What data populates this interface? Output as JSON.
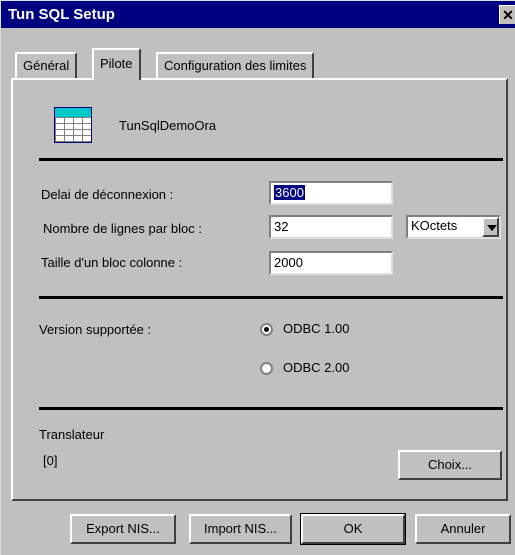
{
  "window": {
    "title": "Tun SQL Setup",
    "close_glyph": "✕"
  },
  "tabs": [
    {
      "label": "Général",
      "active": false
    },
    {
      "label": "Pilote",
      "active": true
    },
    {
      "label": "Configuration des limites",
      "active": false
    }
  ],
  "driver": {
    "name": "TunSqlDemoOra",
    "icon": "table-icon"
  },
  "settings": {
    "timeout_label": "Delai de déconnexion :",
    "timeout_value": "3600",
    "rows_label": "Nombre de lignes par bloc :",
    "rows_value": "32",
    "unit_value": "KOctets",
    "column_label": "Taille d'un bloc colonne :",
    "column_value": "2000"
  },
  "version": {
    "label": "Version supportée :",
    "options": [
      {
        "label": "ODBC 1.00",
        "checked": true
      },
      {
        "label": "ODBC 2.00",
        "checked": false
      }
    ]
  },
  "translator": {
    "label": "Translateur",
    "value": "[0]",
    "choose_label": "Choix..."
  },
  "footer": {
    "export_label": "Export NIS...",
    "import_label": "Import NIS...",
    "ok_label": "OK",
    "cancel_label": "Annuler"
  }
}
